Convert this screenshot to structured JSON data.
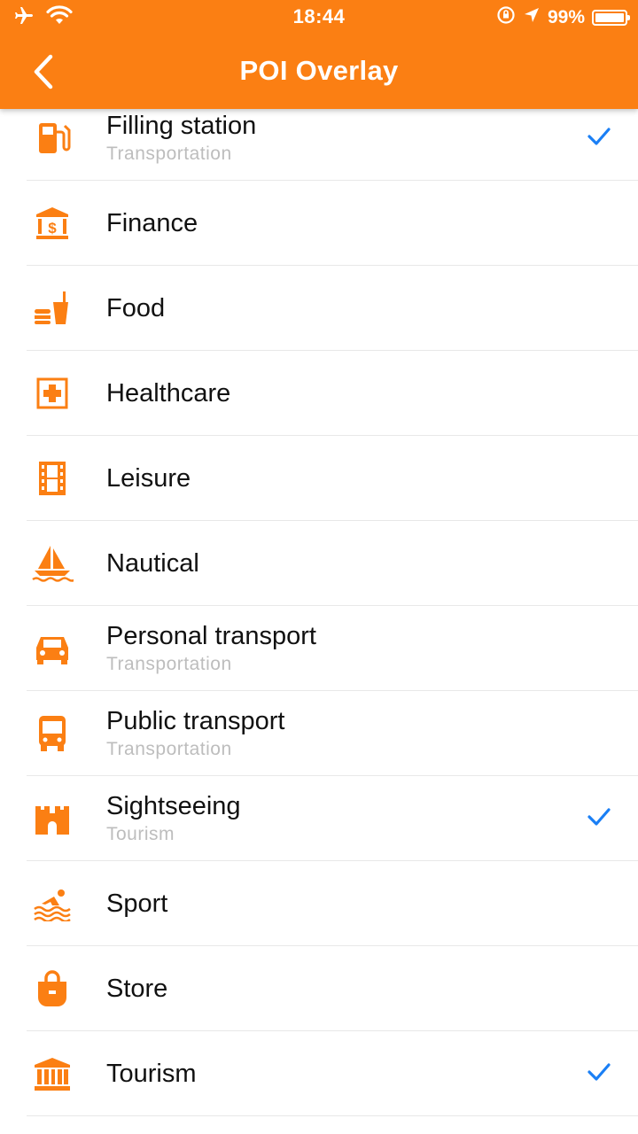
{
  "status_bar": {
    "time": "18:44",
    "battery_percent": "99%",
    "battery_level": 0.99
  },
  "header": {
    "title": "POI Overlay",
    "back_icon": "chevron-left-icon"
  },
  "colors": {
    "accent": "#fb7f13",
    "check": "#1a7ff5",
    "subtitle": "#bdbdbd"
  },
  "items": [
    {
      "label": "Filling station",
      "subtitle": "Transportation",
      "checked": true,
      "icon": "fuel-pump-icon"
    },
    {
      "label": "Finance",
      "subtitle": "",
      "checked": false,
      "icon": "bank-icon"
    },
    {
      "label": "Food",
      "subtitle": "",
      "checked": false,
      "icon": "fast-food-icon"
    },
    {
      "label": "Healthcare",
      "subtitle": "",
      "checked": false,
      "icon": "medical-cross-icon"
    },
    {
      "label": "Leisure",
      "subtitle": "",
      "checked": false,
      "icon": "film-strip-icon"
    },
    {
      "label": "Nautical",
      "subtitle": "",
      "checked": false,
      "icon": "sailboat-icon"
    },
    {
      "label": "Personal transport",
      "subtitle": "Transportation",
      "checked": false,
      "icon": "car-icon"
    },
    {
      "label": "Public transport",
      "subtitle": "Transportation",
      "checked": false,
      "icon": "bus-icon"
    },
    {
      "label": "Sightseeing",
      "subtitle": "Tourism",
      "checked": true,
      "icon": "castle-icon"
    },
    {
      "label": "Sport",
      "subtitle": "",
      "checked": false,
      "icon": "swimmer-icon"
    },
    {
      "label": "Store",
      "subtitle": "",
      "checked": false,
      "icon": "shopping-bag-icon"
    },
    {
      "label": "Tourism",
      "subtitle": "",
      "checked": true,
      "icon": "museum-icon"
    }
  ]
}
